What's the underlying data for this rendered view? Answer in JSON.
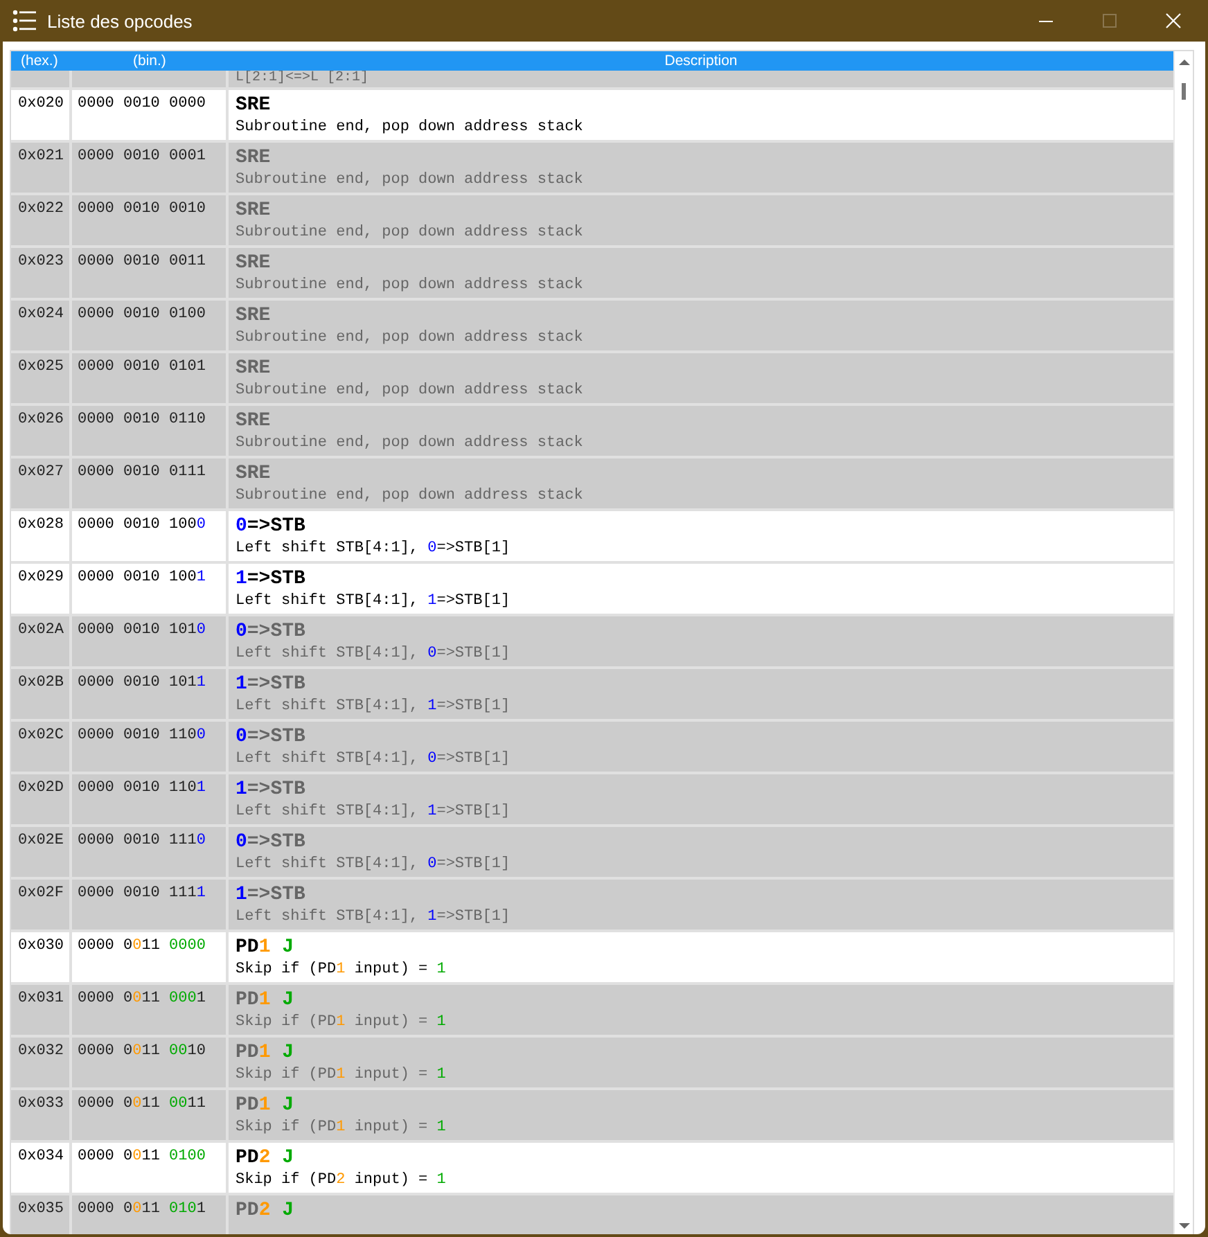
{
  "window": {
    "title": "Liste des opcodes"
  },
  "table": {
    "columns": [
      "(hex.)",
      "(bin.)",
      "Description"
    ],
    "rows": [
      {
        "hex": "",
        "bin": [],
        "mnemonic": [],
        "description": [
          {
            "text": "L[2:1]<=>L [2:1]"
          }
        ],
        "disabled": true
      },
      {
        "hex": "0x020",
        "bin": [
          {
            "text": "0000 0010 0000"
          }
        ],
        "mnemonic": [
          {
            "text": "SRE"
          }
        ],
        "description": [
          {
            "text": "Subroutine end, pop down address stack"
          }
        ],
        "disabled": false
      },
      {
        "hex": "0x021",
        "bin": [
          {
            "text": "0000 0010 0001"
          }
        ],
        "mnemonic": [
          {
            "text": "SRE"
          }
        ],
        "description": [
          {
            "text": "Subroutine end, pop down address stack"
          }
        ],
        "disabled": true
      },
      {
        "hex": "0x022",
        "bin": [
          {
            "text": "0000 0010 0010"
          }
        ],
        "mnemonic": [
          {
            "text": "SRE"
          }
        ],
        "description": [
          {
            "text": "Subroutine end, pop down address stack"
          }
        ],
        "disabled": true
      },
      {
        "hex": "0x023",
        "bin": [
          {
            "text": "0000 0010 0011"
          }
        ],
        "mnemonic": [
          {
            "text": "SRE"
          }
        ],
        "description": [
          {
            "text": "Subroutine end, pop down address stack"
          }
        ],
        "disabled": true
      },
      {
        "hex": "0x024",
        "bin": [
          {
            "text": "0000 0010 0100"
          }
        ],
        "mnemonic": [
          {
            "text": "SRE"
          }
        ],
        "description": [
          {
            "text": "Subroutine end, pop down address stack"
          }
        ],
        "disabled": true
      },
      {
        "hex": "0x025",
        "bin": [
          {
            "text": "0000 0010 0101"
          }
        ],
        "mnemonic": [
          {
            "text": "SRE"
          }
        ],
        "description": [
          {
            "text": "Subroutine end, pop down address stack"
          }
        ],
        "disabled": true
      },
      {
        "hex": "0x026",
        "bin": [
          {
            "text": "0000 0010 0110"
          }
        ],
        "mnemonic": [
          {
            "text": "SRE"
          }
        ],
        "description": [
          {
            "text": "Subroutine end, pop down address stack"
          }
        ],
        "disabled": true
      },
      {
        "hex": "0x027",
        "bin": [
          {
            "text": "0000 0010 0111"
          }
        ],
        "mnemonic": [
          {
            "text": "SRE"
          }
        ],
        "description": [
          {
            "text": "Subroutine end, pop down address stack"
          }
        ],
        "disabled": true
      },
      {
        "hex": "0x028",
        "bin": [
          {
            "text": "0000 0010 100"
          },
          {
            "text": "0",
            "color": "#0000ff"
          }
        ],
        "mnemonic": [
          {
            "text": "0",
            "color": "#0000ff"
          },
          {
            "text": "=>STB"
          }
        ],
        "description": [
          {
            "text": "Left shift STB[4:1], "
          },
          {
            "text": "0",
            "color": "#0000ff"
          },
          {
            "text": "=>STB[1]"
          }
        ],
        "disabled": false
      },
      {
        "hex": "0x029",
        "bin": [
          {
            "text": "0000 0010 100"
          },
          {
            "text": "1",
            "color": "#0000ff"
          }
        ],
        "mnemonic": [
          {
            "text": "1",
            "color": "#0000ff"
          },
          {
            "text": "=>STB"
          }
        ],
        "description": [
          {
            "text": "Left shift STB[4:1], "
          },
          {
            "text": "1",
            "color": "#0000ff"
          },
          {
            "text": "=>STB[1]"
          }
        ],
        "disabled": false
      },
      {
        "hex": "0x02A",
        "bin": [
          {
            "text": "0000 0010 101"
          },
          {
            "text": "0",
            "color": "#0000ff"
          }
        ],
        "mnemonic": [
          {
            "text": "0",
            "color": "#0000ff"
          },
          {
            "text": "=>STB"
          }
        ],
        "description": [
          {
            "text": "Left shift STB[4:1], "
          },
          {
            "text": "0",
            "color": "#0000ff"
          },
          {
            "text": "=>STB[1]"
          }
        ],
        "disabled": true
      },
      {
        "hex": "0x02B",
        "bin": [
          {
            "text": "0000 0010 101"
          },
          {
            "text": "1",
            "color": "#0000ff"
          }
        ],
        "mnemonic": [
          {
            "text": "1",
            "color": "#0000ff"
          },
          {
            "text": "=>STB"
          }
        ],
        "description": [
          {
            "text": "Left shift STB[4:1], "
          },
          {
            "text": "1",
            "color": "#0000ff"
          },
          {
            "text": "=>STB[1]"
          }
        ],
        "disabled": true
      },
      {
        "hex": "0x02C",
        "bin": [
          {
            "text": "0000 0010 110"
          },
          {
            "text": "0",
            "color": "#0000ff"
          }
        ],
        "mnemonic": [
          {
            "text": "0",
            "color": "#0000ff"
          },
          {
            "text": "=>STB"
          }
        ],
        "description": [
          {
            "text": "Left shift STB[4:1], "
          },
          {
            "text": "0",
            "color": "#0000ff"
          },
          {
            "text": "=>STB[1]"
          }
        ],
        "disabled": true
      },
      {
        "hex": "0x02D",
        "bin": [
          {
            "text": "0000 0010 110"
          },
          {
            "text": "1",
            "color": "#0000ff"
          }
        ],
        "mnemonic": [
          {
            "text": "1",
            "color": "#0000ff"
          },
          {
            "text": "=>STB"
          }
        ],
        "description": [
          {
            "text": "Left shift STB[4:1], "
          },
          {
            "text": "1",
            "color": "#0000ff"
          },
          {
            "text": "=>STB[1]"
          }
        ],
        "disabled": true
      },
      {
        "hex": "0x02E",
        "bin": [
          {
            "text": "0000 0010 111"
          },
          {
            "text": "0",
            "color": "#0000ff"
          }
        ],
        "mnemonic": [
          {
            "text": "0",
            "color": "#0000ff"
          },
          {
            "text": "=>STB"
          }
        ],
        "description": [
          {
            "text": "Left shift STB[4:1], "
          },
          {
            "text": "0",
            "color": "#0000ff"
          },
          {
            "text": "=>STB[1]"
          }
        ],
        "disabled": true
      },
      {
        "hex": "0x02F",
        "bin": [
          {
            "text": "0000 0010 111"
          },
          {
            "text": "1",
            "color": "#0000ff"
          }
        ],
        "mnemonic": [
          {
            "text": "1",
            "color": "#0000ff"
          },
          {
            "text": "=>STB"
          }
        ],
        "description": [
          {
            "text": "Left shift STB[4:1], "
          },
          {
            "text": "1",
            "color": "#0000ff"
          },
          {
            "text": "=>STB[1]"
          }
        ],
        "disabled": true
      },
      {
        "hex": "0x030",
        "bin": [
          {
            "text": "0000 0"
          },
          {
            "text": "0",
            "color": "#ff9900"
          },
          {
            "text": "11 "
          },
          {
            "text": "0000",
            "color": "#00aa00"
          }
        ],
        "mnemonic": [
          {
            "text": "PD"
          },
          {
            "text": "1",
            "color": "#ff9900"
          },
          {
            "text": " J",
            "color": "#00aa00"
          }
        ],
        "description": [
          {
            "text": "Skip if (PD"
          },
          {
            "text": "1",
            "color": "#ff9900"
          },
          {
            "text": " input) = "
          },
          {
            "text": "1",
            "color": "#00aa00"
          }
        ],
        "disabled": false
      },
      {
        "hex": "0x031",
        "bin": [
          {
            "text": "0000 0"
          },
          {
            "text": "0",
            "color": "#ff9900"
          },
          {
            "text": "11 "
          },
          {
            "text": "000",
            "color": "#00aa00"
          },
          {
            "text": "1"
          }
        ],
        "mnemonic": [
          {
            "text": "PD"
          },
          {
            "text": "1",
            "color": "#ff9900"
          },
          {
            "text": " J",
            "color": "#00aa00"
          }
        ],
        "description": [
          {
            "text": "Skip if (PD"
          },
          {
            "text": "1",
            "color": "#ff9900"
          },
          {
            "text": " input) = "
          },
          {
            "text": "1",
            "color": "#00aa00"
          }
        ],
        "disabled": true
      },
      {
        "hex": "0x032",
        "bin": [
          {
            "text": "0000 0"
          },
          {
            "text": "0",
            "color": "#ff9900"
          },
          {
            "text": "11 "
          },
          {
            "text": "00",
            "color": "#00aa00"
          },
          {
            "text": "10"
          }
        ],
        "mnemonic": [
          {
            "text": "PD"
          },
          {
            "text": "1",
            "color": "#ff9900"
          },
          {
            "text": " J",
            "color": "#00aa00"
          }
        ],
        "description": [
          {
            "text": "Skip if (PD"
          },
          {
            "text": "1",
            "color": "#ff9900"
          },
          {
            "text": " input) = "
          },
          {
            "text": "1",
            "color": "#00aa00"
          }
        ],
        "disabled": true
      },
      {
        "hex": "0x033",
        "bin": [
          {
            "text": "0000 0"
          },
          {
            "text": "0",
            "color": "#ff9900"
          },
          {
            "text": "11 "
          },
          {
            "text": "00",
            "color": "#00aa00"
          },
          {
            "text": "11"
          }
        ],
        "mnemonic": [
          {
            "text": "PD"
          },
          {
            "text": "1",
            "color": "#ff9900"
          },
          {
            "text": " J",
            "color": "#00aa00"
          }
        ],
        "description": [
          {
            "text": "Skip if (PD"
          },
          {
            "text": "1",
            "color": "#ff9900"
          },
          {
            "text": " input) = "
          },
          {
            "text": "1",
            "color": "#00aa00"
          }
        ],
        "disabled": true
      },
      {
        "hex": "0x034",
        "bin": [
          {
            "text": "0000 0"
          },
          {
            "text": "0",
            "color": "#ff9900"
          },
          {
            "text": "11 "
          },
          {
            "text": "0100",
            "color": "#00aa00"
          }
        ],
        "mnemonic": [
          {
            "text": "PD"
          },
          {
            "text": "2",
            "color": "#ff9900"
          },
          {
            "text": " J",
            "color": "#00aa00"
          }
        ],
        "description": [
          {
            "text": "Skip if (PD"
          },
          {
            "text": "2",
            "color": "#ff9900"
          },
          {
            "text": " input) = "
          },
          {
            "text": "1",
            "color": "#00aa00"
          }
        ],
        "disabled": false
      },
      {
        "hex": "0x035",
        "bin": [
          {
            "text": "0000 0"
          },
          {
            "text": "0",
            "color": "#ff9900"
          },
          {
            "text": "11 "
          },
          {
            "text": "010",
            "color": "#00aa00"
          },
          {
            "text": "1"
          }
        ],
        "mnemonic": [
          {
            "text": "PD"
          },
          {
            "text": "2",
            "color": "#ff9900"
          },
          {
            "text": " J",
            "color": "#00aa00"
          }
        ],
        "description": [],
        "disabled": true
      }
    ]
  }
}
